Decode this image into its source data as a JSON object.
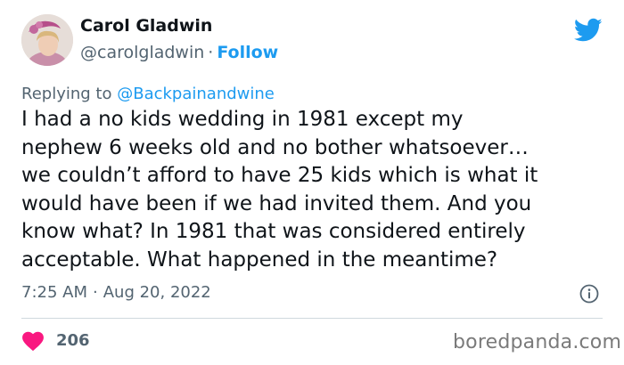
{
  "author": {
    "name": "Carol Gladwin",
    "handle": "@carolgladwin",
    "separator": "·",
    "follow_label": "Follow",
    "avatar_icon": "avatar-photo"
  },
  "brand": {
    "icon": "twitter-bird-icon",
    "color": "#1d9bf0"
  },
  "reply": {
    "prefix": "Replying to",
    "mention": "@Backpainandwine"
  },
  "tweet": {
    "lines": [
      "I had a no kids wedding in 1981 except my",
      "nephew 6 weeks old and no bother whatsoever…",
      "we couldn’t afford to have 25 kids which is what it",
      "would have been if we had invited them. And you",
      "know what? In 1981 that was considered entirely",
      "acceptable. What happened in the meantime?"
    ]
  },
  "meta": {
    "time": "7:25 AM",
    "separator": "·",
    "date": "Aug 20, 2022",
    "info_icon": "info-icon"
  },
  "engagement": {
    "likes": "206",
    "heart_color": "#f91880"
  },
  "watermark": "boredpanda.com"
}
